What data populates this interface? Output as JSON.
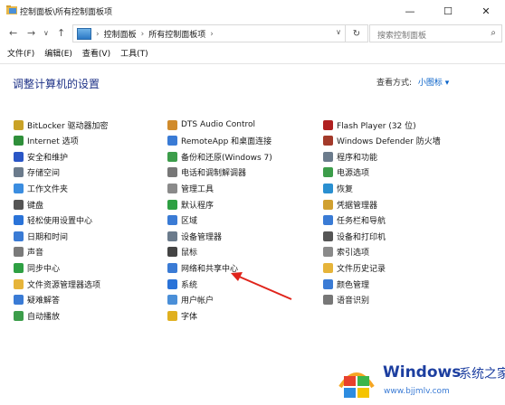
{
  "window": {
    "title": "控制面板\\所有控制面板项",
    "controls": {
      "minimize": "—",
      "maximize": "☐",
      "close": "✕"
    }
  },
  "address": {
    "crumbs": [
      "控制面板",
      "所有控制面板项"
    ],
    "search_placeholder": "搜索控制面板"
  },
  "menu": [
    "文件(F)",
    "编辑(E)",
    "查看(V)",
    "工具(T)"
  ],
  "header": {
    "title": "调整计算机的设置",
    "view_by_label": "查看方式:",
    "view_by_value": "小图标 ▾"
  },
  "columns": [
    [
      {
        "label": "BitLocker 驱动器加密",
        "icon": "bitlocker-icon",
        "color": "#c9a227"
      },
      {
        "label": "Internet 选项",
        "icon": "internet-options-icon",
        "color": "#2f8f3a"
      },
      {
        "label": "安全和维护",
        "icon": "security-flag-icon",
        "color": "#2a56c6"
      },
      {
        "label": "存储空间",
        "icon": "storage-spaces-icon",
        "color": "#6b7b8c"
      },
      {
        "label": "工作文件夹",
        "icon": "work-folders-icon",
        "color": "#3b8de0"
      },
      {
        "label": "键盘",
        "icon": "keyboard-icon",
        "color": "#555555"
      },
      {
        "label": "轻松使用设置中心",
        "icon": "ease-of-access-icon",
        "color": "#2a73d8"
      },
      {
        "label": "日期和时间",
        "icon": "date-time-icon",
        "color": "#3a7bd5"
      },
      {
        "label": "声音",
        "icon": "sound-icon",
        "color": "#7a7a7a"
      },
      {
        "label": "同步中心",
        "icon": "sync-center-icon",
        "color": "#2ea043"
      },
      {
        "label": "文件资源管理器选项",
        "icon": "folder-options-icon",
        "color": "#e6b43a"
      },
      {
        "label": "疑难解答",
        "icon": "troubleshooting-icon",
        "color": "#3a7bd5"
      },
      {
        "label": "自动播放",
        "icon": "autoplay-icon",
        "color": "#3c9d4a"
      }
    ],
    [
      {
        "label": "DTS Audio Control",
        "icon": "dts-audio-icon",
        "color": "#d08b2c"
      },
      {
        "label": "RemoteApp 和桌面连接",
        "icon": "remoteapp-icon",
        "color": "#3a7bd5"
      },
      {
        "label": "备份和还原(Windows 7)",
        "icon": "backup-restore-icon",
        "color": "#3c9d4a"
      },
      {
        "label": "电话和调制解调器",
        "icon": "phone-modem-icon",
        "color": "#777777"
      },
      {
        "label": "管理工具",
        "icon": "admin-tools-icon",
        "color": "#8a8a8a"
      },
      {
        "label": "默认程序",
        "icon": "default-programs-icon",
        "color": "#2ea043"
      },
      {
        "label": "区域",
        "icon": "region-icon",
        "color": "#3a7bd5"
      },
      {
        "label": "设备管理器",
        "icon": "device-manager-icon",
        "color": "#6b7b8c"
      },
      {
        "label": "鼠标",
        "icon": "mouse-icon",
        "color": "#444444"
      },
      {
        "label": "网络和共享中心",
        "icon": "network-sharing-icon",
        "color": "#3a7bd5"
      },
      {
        "label": "系统",
        "icon": "system-icon",
        "color": "#2a73d8"
      },
      {
        "label": "用户帐户",
        "icon": "user-accounts-icon",
        "color": "#4a8fd8"
      },
      {
        "label": "字体",
        "icon": "fonts-icon",
        "color": "#e0b020"
      }
    ],
    [
      {
        "label": "Flash Player (32 位)",
        "icon": "flash-player-icon",
        "color": "#b02020"
      },
      {
        "label": "Windows Defender 防火墙",
        "icon": "firewall-icon",
        "color": "#a33a2a"
      },
      {
        "label": "程序和功能",
        "icon": "programs-features-icon",
        "color": "#6b7b8c"
      },
      {
        "label": "电源选项",
        "icon": "power-options-icon",
        "color": "#3c9d4a"
      },
      {
        "label": "恢复",
        "icon": "recovery-icon",
        "color": "#2a8fd0"
      },
      {
        "label": "凭据管理器",
        "icon": "credential-manager-icon",
        "color": "#d0a030"
      },
      {
        "label": "任务栏和导航",
        "icon": "taskbar-icon",
        "color": "#3a7bd5"
      },
      {
        "label": "设备和打印机",
        "icon": "devices-printers-icon",
        "color": "#555555"
      },
      {
        "label": "索引选项",
        "icon": "indexing-icon",
        "color": "#8a8a8a"
      },
      {
        "label": "文件历史记录",
        "icon": "file-history-icon",
        "color": "#e6b43a"
      },
      {
        "label": "颜色管理",
        "icon": "color-management-icon",
        "color": "#3a7bd5"
      },
      {
        "label": "语音识别",
        "icon": "speech-recognition-icon",
        "color": "#777777"
      }
    ]
  ],
  "watermark": {
    "brand": "Windows",
    "brand_suffix": "系统之家",
    "url": "www.bjjmlv.com"
  }
}
